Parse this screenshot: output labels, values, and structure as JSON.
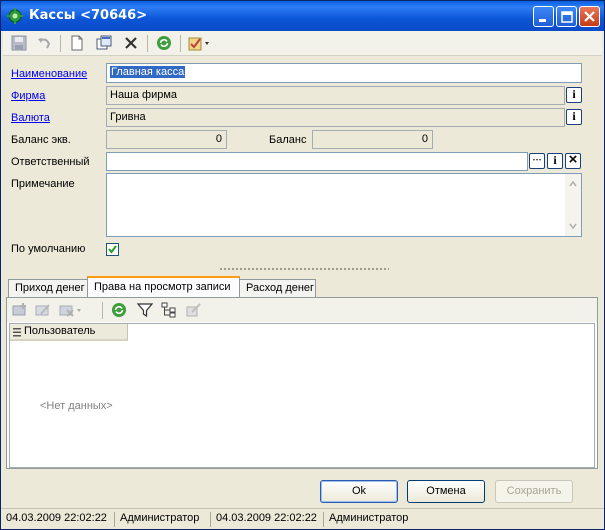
{
  "window": {
    "title": "Кассы <70646>"
  },
  "form": {
    "name_label": "Наименование",
    "name_value": "Главная касса",
    "firm_label": "Фирма",
    "firm_value": "Наша фирма",
    "currency_label": "Валюта",
    "currency_value": "Гривна",
    "balance_eq_label": "Баланс экв.",
    "balance_eq_value": "0",
    "balance_label": "Баланс",
    "balance_value": "0",
    "responsible_label": "Ответственный",
    "responsible_value": "",
    "note_label": "Примечание",
    "note_value": "",
    "default_label": "По умолчанию",
    "default_checked": true,
    "info_glyph": "i",
    "more_glyph": "···",
    "clear_glyph": "×"
  },
  "tabs": [
    {
      "label": "Приход денег",
      "active": false
    },
    {
      "label": "Права на просмотр записи",
      "active": true
    },
    {
      "label": "Расход денег",
      "active": false
    }
  ],
  "grid": {
    "columns": [
      "Пользователь"
    ],
    "empty_text": "<Нет данных>"
  },
  "buttons": {
    "ok": "Ok",
    "cancel": "Отмена",
    "save": "Сохранить"
  },
  "status": {
    "created_at": "04.03.2009 22:02:22",
    "created_by": "Администратор",
    "modified_at": "04.03.2009 22:02:22",
    "modified_by": "Администратор"
  },
  "icons": {
    "toolbar": [
      "save-icon",
      "undo-icon",
      "new-document-icon",
      "copy-icon",
      "delete-icon",
      "refresh-icon",
      "actions-dropdown-icon"
    ],
    "panel_toolbar": [
      "add-row-icon",
      "edit-row-icon",
      "delete-row-icon",
      "refresh-icon",
      "filter-icon",
      "hierarchy-icon",
      "set-icon"
    ]
  }
}
